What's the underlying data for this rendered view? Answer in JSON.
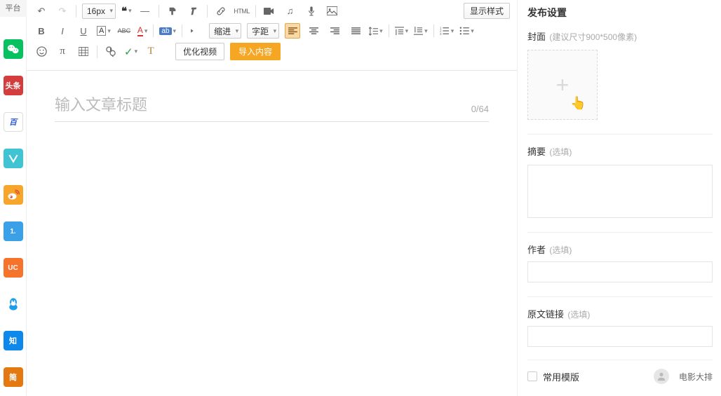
{
  "sidebar": {
    "platform_label": "平台",
    "channels": [
      "微",
      "头条",
      "百",
      "M",
      "微",
      "1.",
      "UC",
      "Q",
      "知",
      "简"
    ]
  },
  "toolbar": {
    "font_size": "16px",
    "indent_label": "缩进",
    "spacing_label": "字距",
    "show_style": "显示样式",
    "optimize_video": "优化视频",
    "import_content": "导入内容",
    "html_label": "HTML"
  },
  "editor": {
    "title_placeholder": "输入文章标题",
    "title_count": "0/64"
  },
  "publish": {
    "panel_title": "发布设置",
    "cover_label": "封面",
    "cover_hint": "(建议尺寸900*500像素)",
    "summary_label": "摘要",
    "summary_hint": "(选填)",
    "author_label": "作者",
    "author_hint": "(选填)",
    "source_label": "原文链接",
    "source_hint": "(选填)",
    "template_label": "常用模版",
    "template_example": "电影大排"
  }
}
